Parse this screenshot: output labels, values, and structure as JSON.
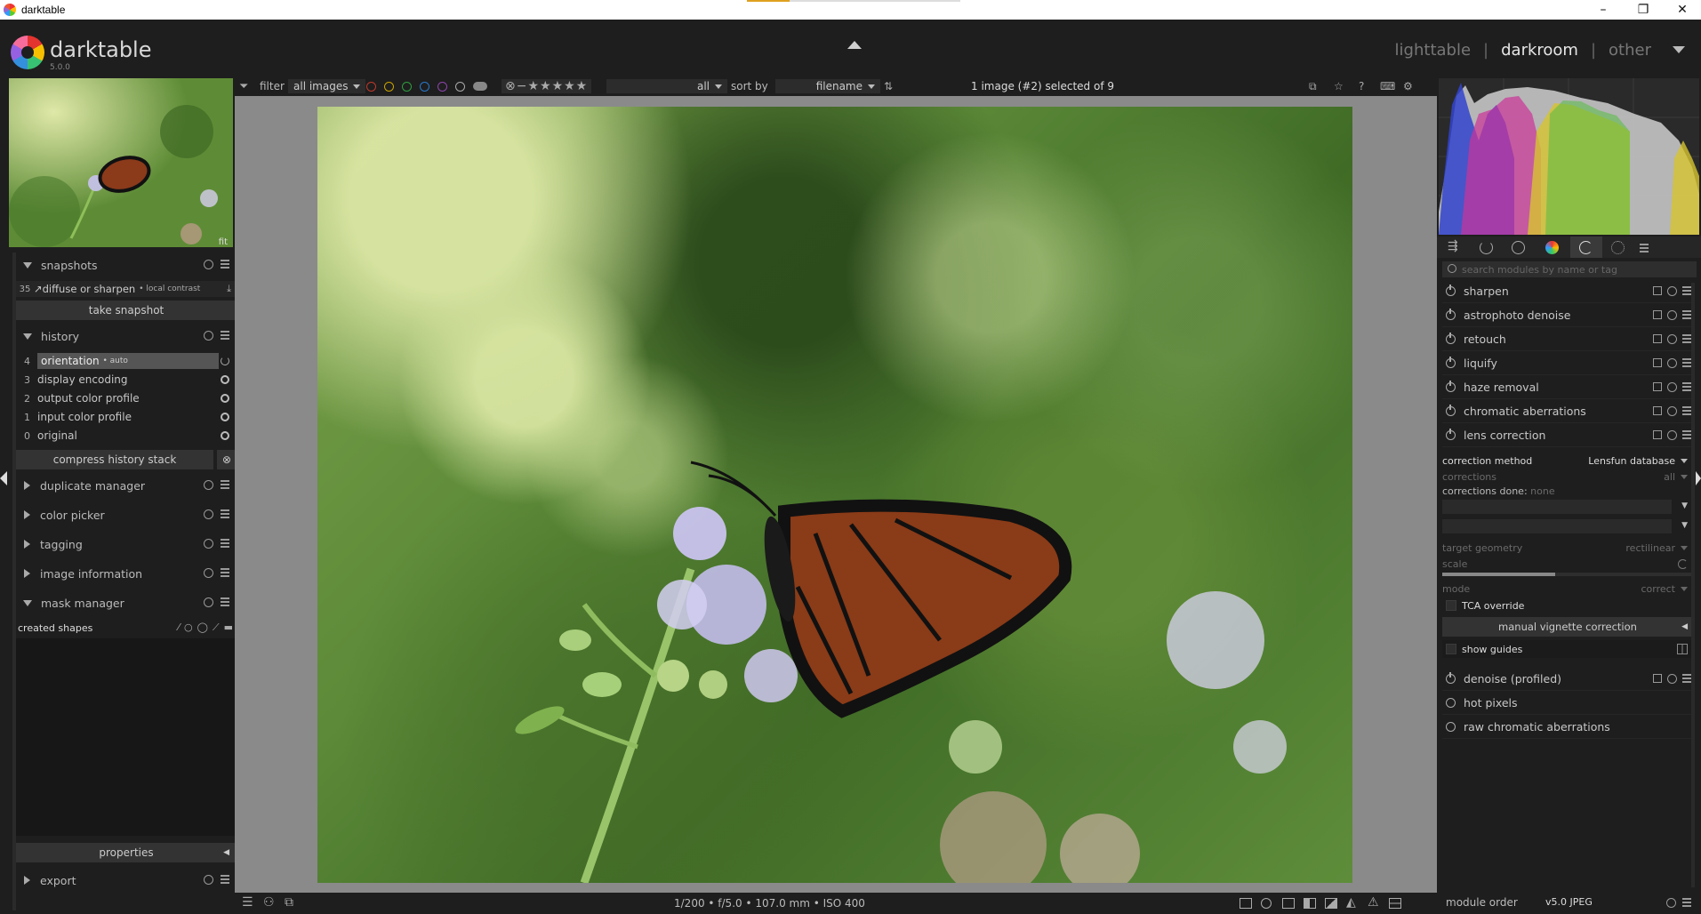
{
  "window": {
    "title": "darktable",
    "minimize": "–",
    "maximize": "❐",
    "close": "✕"
  },
  "header": {
    "brand": "darktable",
    "version": "5.0.0",
    "views": [
      "lighttable",
      "darkroom",
      "other"
    ],
    "active_view": "darkroom",
    "separator": "|"
  },
  "filterbar": {
    "filter_label": "filter",
    "filter_value": "all images",
    "color_labels": [
      "#c0392b",
      "#c9a400",
      "#2e9e3e",
      "#2a77c9",
      "#8e44ad"
    ],
    "rating_value": "all",
    "sort_label": "sort by",
    "sort_value": "filename",
    "selection_text": "1 image (#2) selected of 9"
  },
  "left": {
    "thumbnail_zoom": "fit",
    "snapshots": {
      "title": "snapshots",
      "entry_num": "35",
      "entry_text": "↗diffuse or sharpen",
      "entry_sub": "• local contrast",
      "take_snapshot": "take snapshot"
    },
    "history": {
      "title": "history",
      "items": [
        {
          "num": "4",
          "label": "orientation",
          "sub": "• auto"
        },
        {
          "num": "3",
          "label": "display encoding",
          "sub": ""
        },
        {
          "num": "2",
          "label": "output color profile",
          "sub": ""
        },
        {
          "num": "1",
          "label": "input color profile",
          "sub": ""
        },
        {
          "num": "0",
          "label": "original",
          "sub": ""
        }
      ],
      "compress": "compress history stack"
    },
    "collapsed_modules": [
      "duplicate manager",
      "color picker",
      "tagging",
      "image information"
    ],
    "mask_manager": {
      "title": "mask manager",
      "created_shapes": "created shapes",
      "properties": "properties"
    },
    "export": "export"
  },
  "status": {
    "exif": "1/200 • f/5.0 • 107.0 mm • ISO 400"
  },
  "right": {
    "search_placeholder": "search modules by name or tag",
    "modules": [
      {
        "name": "sharpen",
        "on": true
      },
      {
        "name": "astrophoto denoise",
        "on": true
      },
      {
        "name": "retouch",
        "on": true
      },
      {
        "name": "liquify",
        "on": true
      },
      {
        "name": "haze removal",
        "on": true
      },
      {
        "name": "chromatic aberrations",
        "on": true
      },
      {
        "name": "lens correction",
        "on": true
      }
    ],
    "lens": {
      "correction_method_label": "correction method",
      "correction_method_value": "Lensfun database",
      "corrections_label": "corrections",
      "corrections_value": "all",
      "corrections_done_label": "corrections done:",
      "corrections_done_value": "none",
      "target_geometry_label": "target geometry",
      "target_geometry_value": "rectilinear",
      "scale_label": "scale",
      "scale_fraction": 0.45,
      "mode_label": "mode",
      "mode_value": "correct",
      "tca_override": "TCA override",
      "manual_vignette": "manual vignette correction",
      "show_guides": "show guides"
    },
    "modules_after": [
      {
        "name": "denoise (profiled)",
        "on": true
      },
      {
        "name": "hot pixels",
        "on": false
      },
      {
        "name": "raw chromatic aberrations",
        "on": false
      }
    ],
    "module_order_label": "module order",
    "module_order_value": "v5.0 JPEG"
  }
}
